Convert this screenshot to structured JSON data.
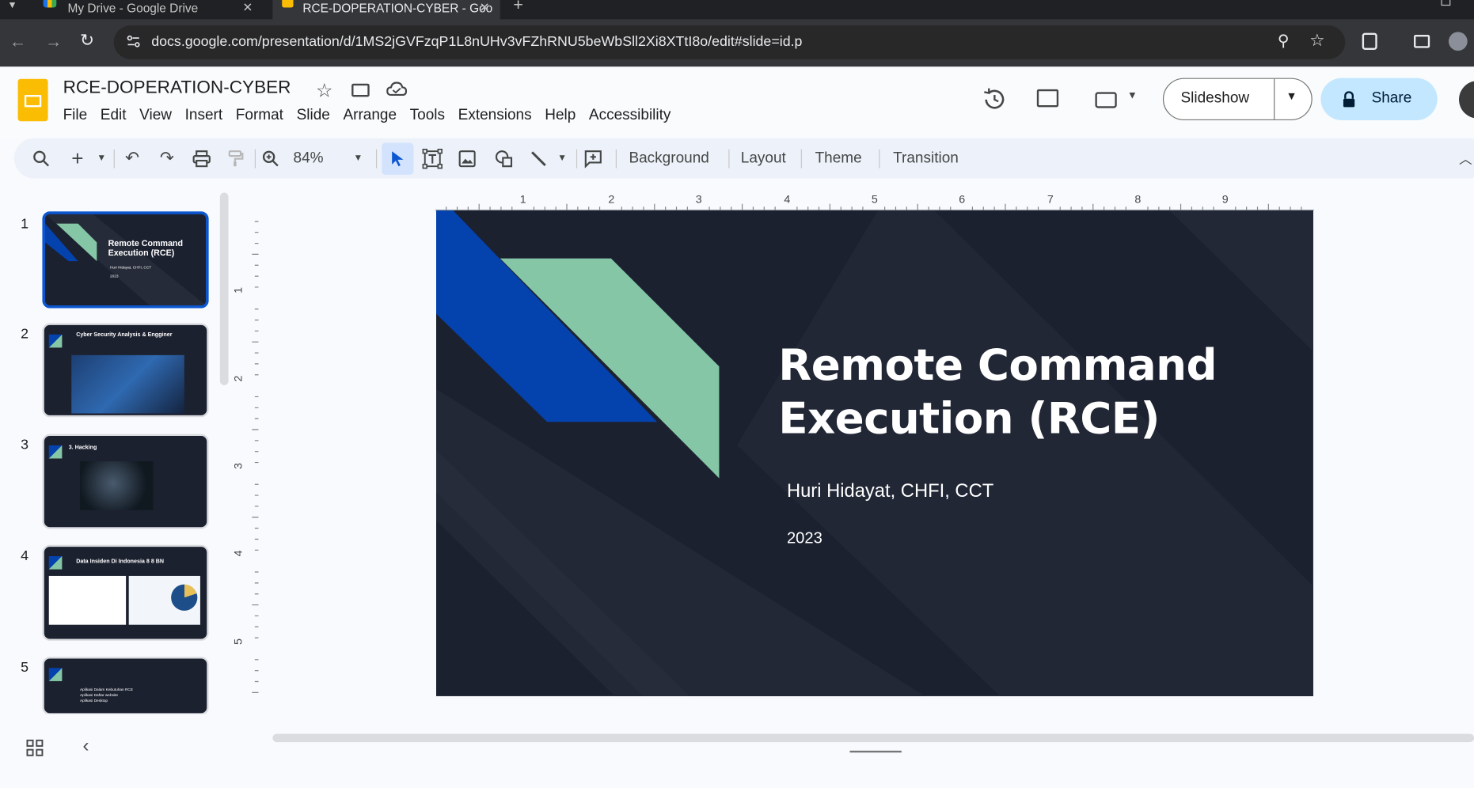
{
  "browser": {
    "tabs": [
      {
        "title": "My Drive - Google Drive",
        "active": false
      },
      {
        "title": "RCE-DOPERATION-CYBER - Goo",
        "active": true
      }
    ],
    "url": "docs.google.com/presentation/d/1MS2jGVFzqP1L8nUHv3vFZhRNU5beWbSll2Xi8XTtI8o/edit#slide=id.p",
    "tab_close_glyph": "✕",
    "new_tab_glyph": "+"
  },
  "doc": {
    "title": "RCE-DOPERATION-CYBER",
    "menus": [
      "File",
      "Edit",
      "View",
      "Insert",
      "Format",
      "Slide",
      "Arrange",
      "Tools",
      "Extensions",
      "Help",
      "Accessibility"
    ],
    "slideshow_label": "Slideshow",
    "share_label": "Share"
  },
  "toolbar": {
    "zoom": "84%",
    "background_label": "Background",
    "layout_label": "Layout",
    "theme_label": "Theme",
    "transition_label": "Transition"
  },
  "ruler": {
    "h_labels": [
      "1",
      "2",
      "3",
      "4",
      "5",
      "6",
      "7",
      "8",
      "9"
    ],
    "v_labels": [
      "1",
      "2",
      "3",
      "4",
      "5"
    ]
  },
  "filmstrip": {
    "numbers": [
      "1",
      "2",
      "3",
      "4",
      "5"
    ],
    "slide1_title": "Remote Command Execution (RCE)",
    "slide1_author": "Huri Hidayat, CHFI, CCT",
    "slide1_year": "2023",
    "slide2_title": "Cyber Security Analysis & Engginer",
    "slide3_title": "3. Hacking",
    "slide4_title": "Data Insiden Di Indonesia 8 8 BN",
    "slide5_items": [
      "Aplikasi Dalam Kebutuhan RCE",
      "Aplikasi Daftar website",
      "Aplikasi Desktop"
    ]
  },
  "slide": {
    "title_line1": "Remote Command",
    "title_line2": "Execution (RCE)",
    "author": "Huri Hidayat, CHFI, CCT",
    "year": "2023"
  },
  "colors": {
    "slide_bg": "#1c2130",
    "blue_stripe": "#0442ad",
    "green_stripe": "#84c6a5",
    "share_bg": "#c2e7ff",
    "accent": "#0b57d0"
  }
}
